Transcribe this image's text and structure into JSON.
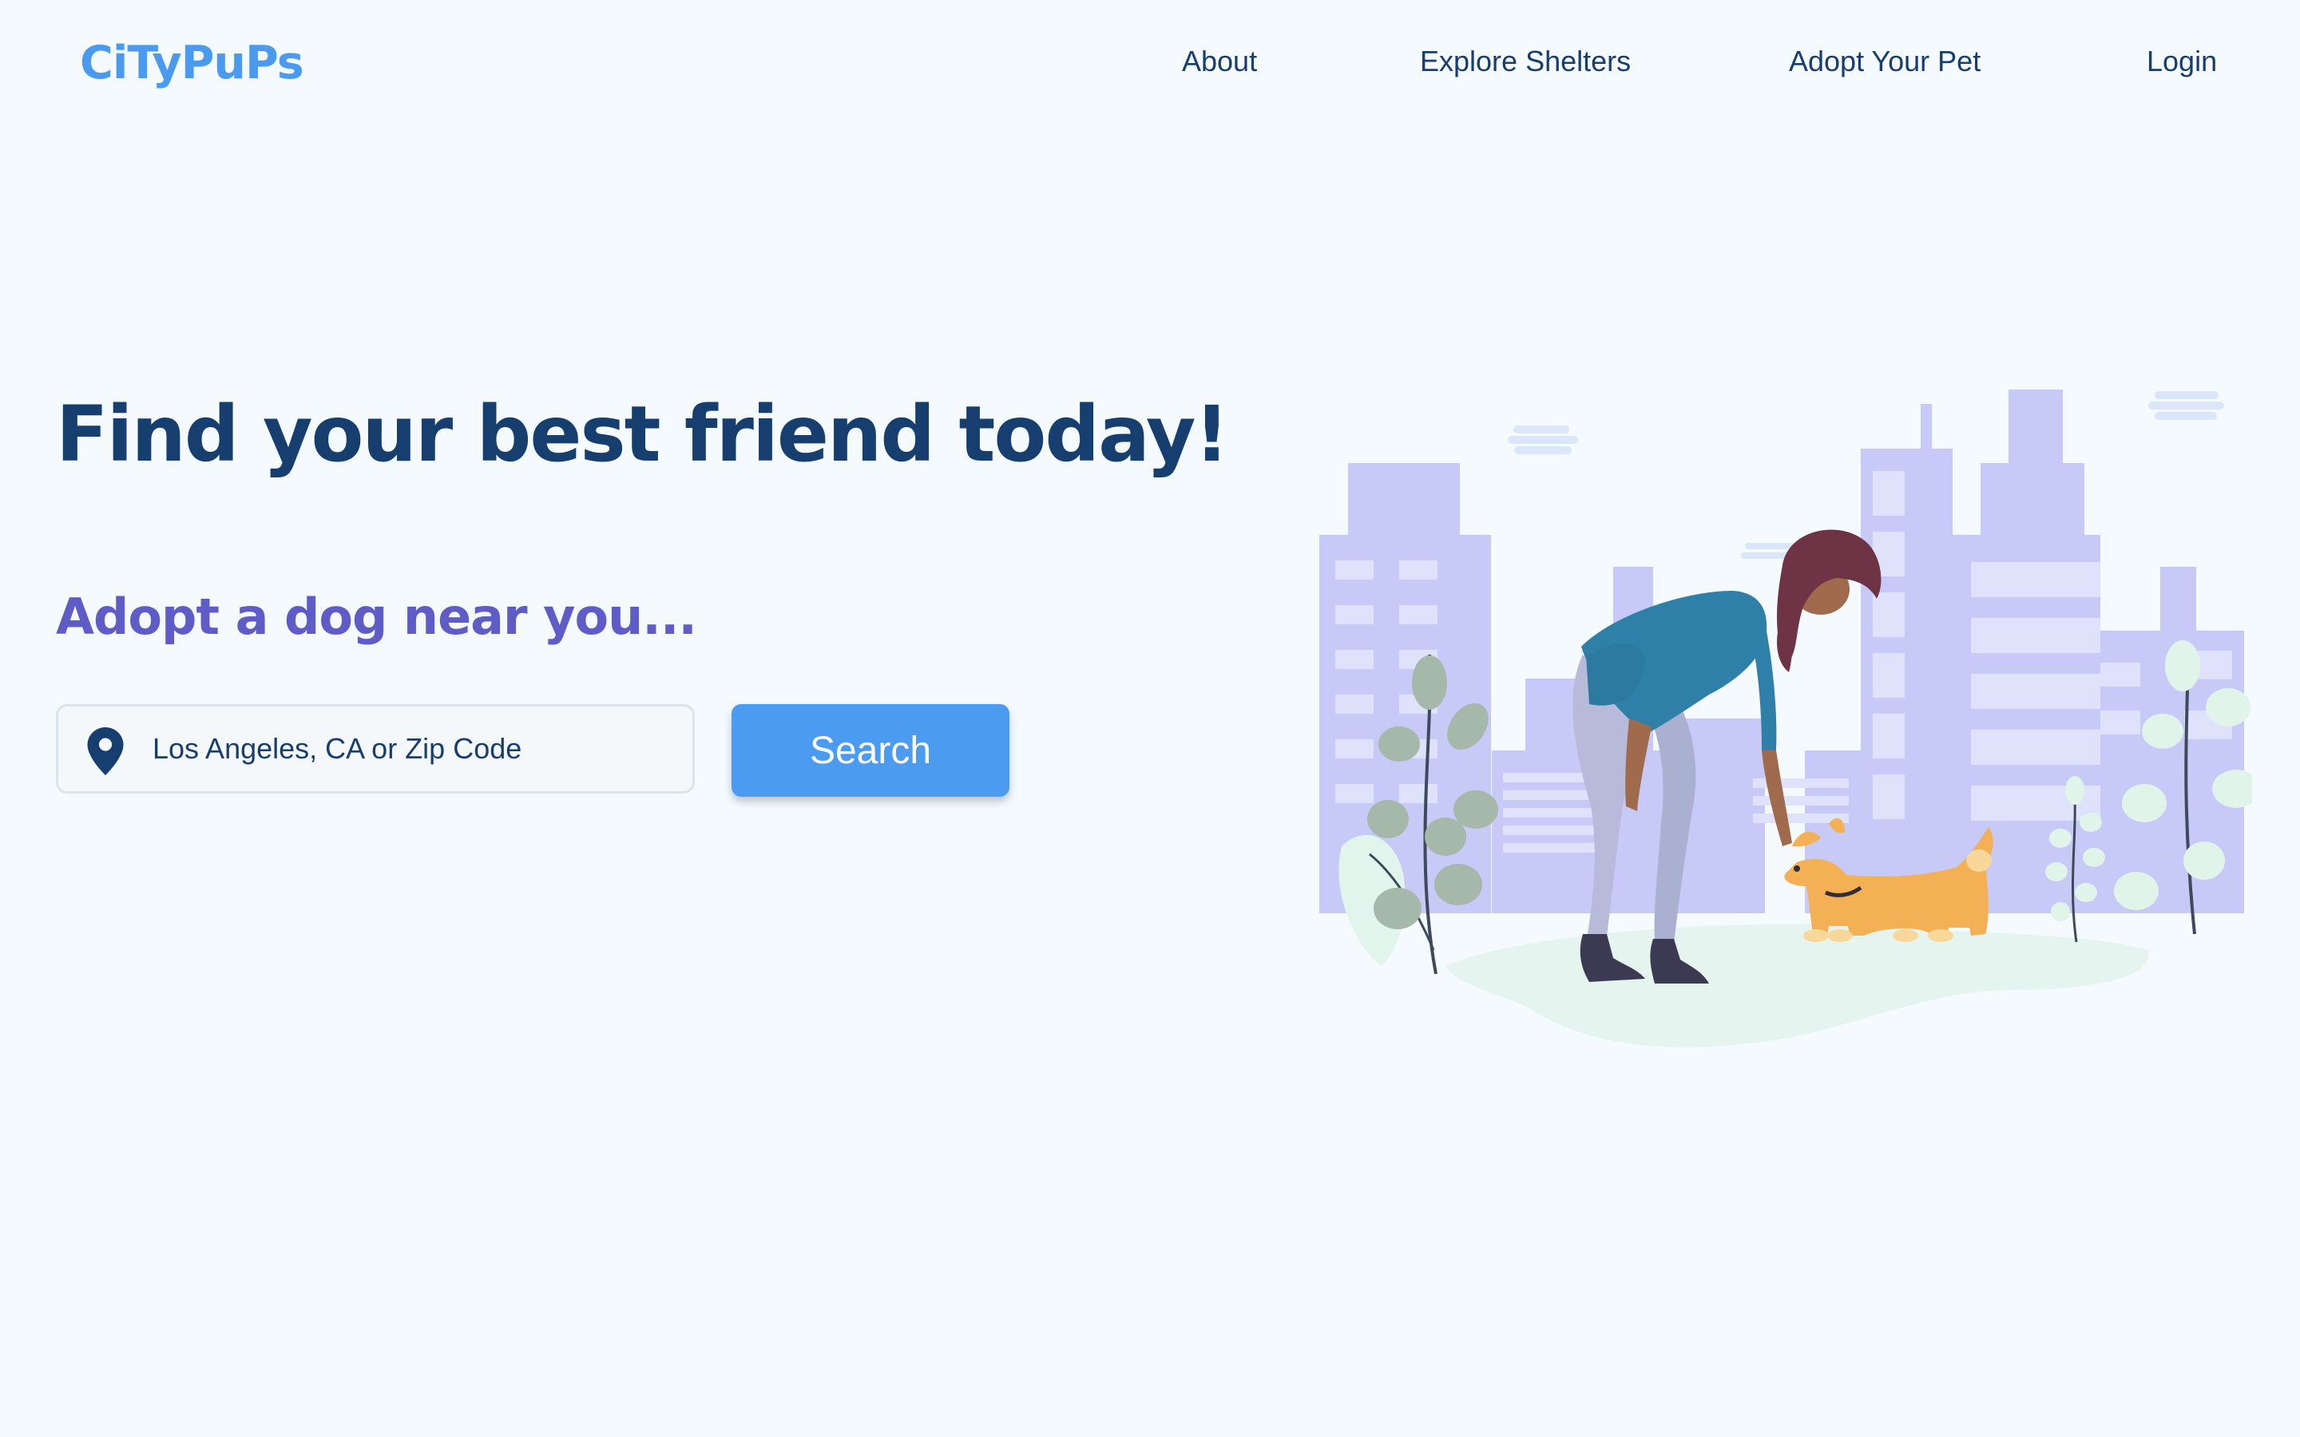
{
  "brand": {
    "name": "CiTyPuPs",
    "color": "#4a9bf0"
  },
  "nav": {
    "items": [
      {
        "label": "About"
      },
      {
        "label": "Explore Shelters"
      },
      {
        "label": "Adopt Your Pet"
      },
      {
        "label": "Login"
      }
    ]
  },
  "hero": {
    "title": "Find your best friend today!",
    "subtitle": "Adopt a dog near you...",
    "search": {
      "placeholder": "Los Angeles, CA or Zip Code",
      "value": "",
      "button_label": "Search",
      "icon": "location-pin-icon"
    }
  },
  "illustration": {
    "subject": "woman-petting-dog-city-illustration"
  },
  "colors": {
    "background": "#f5fafe",
    "primary_text": "#163e6f",
    "accent_purple": "#5f5cc7",
    "button": "#4b9cf1",
    "buildings": "#c7c9f6"
  }
}
